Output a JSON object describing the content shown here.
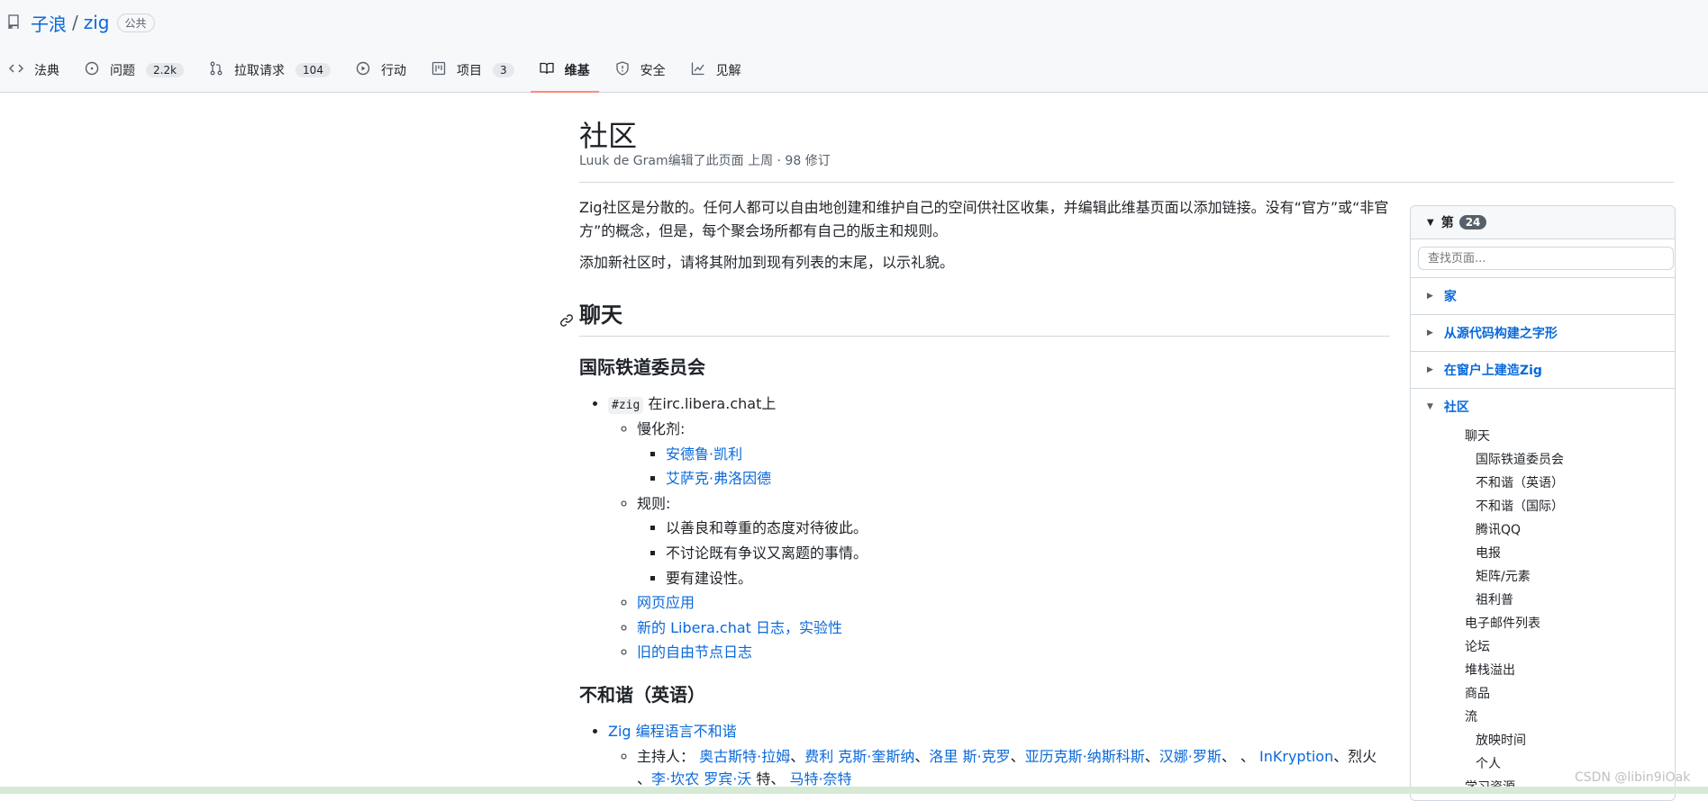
{
  "repo": {
    "owner": "子浪",
    "name": "zig",
    "visibility": "公共"
  },
  "tabs": [
    {
      "label": "法典",
      "icon": "code-icon",
      "count": ""
    },
    {
      "label": "问题",
      "icon": "issue-icon",
      "count": "2.2k"
    },
    {
      "label": "拉取请求",
      "icon": "pull-request-icon",
      "count": "104"
    },
    {
      "label": "行动",
      "icon": "play-icon",
      "count": ""
    },
    {
      "label": "项目",
      "icon": "project-icon",
      "count": "3"
    },
    {
      "label": "维基",
      "icon": "book-icon",
      "count": "",
      "selected": true
    },
    {
      "label": "安全",
      "icon": "shield-icon",
      "count": ""
    },
    {
      "label": "见解",
      "icon": "graph-icon",
      "count": ""
    }
  ],
  "page": {
    "title": "社区",
    "meta": "Luuk de Gram编辑了此页面 上周 · 98 修订",
    "intro1": "Zig社区是分散的。任何人都可以自由地创建和维护自己的空间供社区收集，并编辑此维基页面以添加链接。没有“官方”或“非官方”的概念，但是，每个聚会场所都有自己的版主和规则。",
    "intro2": "添加新社区时，请将其附加到现有列表的末尾，以示礼貌。",
    "h_chat": "聊天",
    "h_irc": "国际铁道委员会",
    "irc_code": "#zig",
    "irc_text": "在irc.libera.chat上",
    "moderators_label": "慢化剂:",
    "moderators": [
      "安德鲁·凯利",
      "艾萨克·弗洛因德"
    ],
    "rules_label": "规则:",
    "rules": [
      "以善良和尊重的态度对待彼此。",
      "不讨论既有争议又离题的事情。",
      "要有建设性。"
    ],
    "irc_links": [
      "网页应用",
      "新的 Libera.chat 日志，实验性",
      "旧的自由节点日志"
    ],
    "h_discord": "不和谐（英语）",
    "discord_link": "Zig 编程语言不和谐",
    "hosts_label": "主持人：",
    "hosts_links_1": [
      "奥古斯特·拉姆",
      "费利 克斯·奎斯纳",
      "洛里 斯·克罗",
      "亚历克斯·纳斯科斯",
      "汉娜·罗斯"
    ],
    "hosts_tail_1a": "、",
    "hosts_link_inkryption": "InKryption",
    "hosts_tail_1b": "、烈火",
    "hosts_line2_prefix": "、",
    "hosts_link_line2a": "李·坎农 罗宾·沃",
    "hosts_line2_mid": " 特、",
    "hosts_link_line2b": "马特·奈特"
  },
  "sidebar": {
    "head_label": "第",
    "count": "24",
    "search_placeholder": "查找页面...",
    "pages": [
      "家",
      "从源代码构建之字形",
      "在窗户上建造Zig",
      "社区"
    ],
    "sub": [
      {
        "label": "聊天",
        "level": 2
      },
      {
        "label": "国际铁道委员会",
        "level": 3
      },
      {
        "label": "不和谐（英语）",
        "level": 3
      },
      {
        "label": "不和谐（国际）",
        "level": 3
      },
      {
        "label": "腾讯QQ",
        "level": 3
      },
      {
        "label": "电报",
        "level": 3
      },
      {
        "label": "矩阵/元素",
        "level": 3
      },
      {
        "label": "祖利普",
        "level": 3
      },
      {
        "label": "电子邮件列表",
        "level": 2
      },
      {
        "label": "论坛",
        "level": 2
      },
      {
        "label": "堆栈溢出",
        "level": 2
      },
      {
        "label": "商品",
        "level": 2
      },
      {
        "label": "流",
        "level": 2
      },
      {
        "label": "放映时间",
        "level": 3
      },
      {
        "label": "个人",
        "level": 3
      },
      {
        "label": "学习资源",
        "level": 2
      }
    ]
  },
  "watermark": "CSDN @libin9iOak",
  "colors": {
    "link": "#0969da",
    "tab_underline": "#fd8c73",
    "header_bg": "#f6f8fa"
  }
}
